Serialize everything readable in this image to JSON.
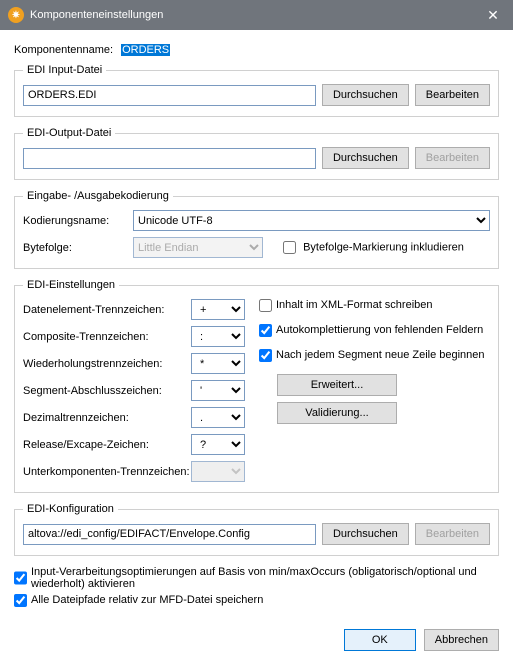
{
  "titlebar": {
    "title": "Komponenteneinstellungen"
  },
  "componentName": {
    "label": "Komponentenname:",
    "value": "ORDERS"
  },
  "ediInput": {
    "legend": "EDI Input-Datei",
    "value": "ORDERS.EDI",
    "browse": "Durchsuchen",
    "edit": "Bearbeiten"
  },
  "ediOutput": {
    "legend": "EDI-Output-Datei",
    "value": "",
    "browse": "Durchsuchen",
    "edit": "Bearbeiten"
  },
  "encoding": {
    "legend": "Eingabe- /Ausgabekodierung",
    "nameLabel": "Kodierungsname:",
    "nameValue": "Unicode UTF-8",
    "byteOrderLabel": "Bytefolge:",
    "byteOrderValue": "Little Endian",
    "bomLabel": "Bytefolge-Markierung inkludieren"
  },
  "ediSettings": {
    "legend": "EDI-Einstellungen",
    "separators": {
      "dataElement": {
        "label": "Datenelement-Trennzeichen:",
        "value": "+"
      },
      "composite": {
        "label": "Composite-Trennzeichen:",
        "value": ":"
      },
      "repetition": {
        "label": "Wiederholungstrennzeichen:",
        "value": "*"
      },
      "segment": {
        "label": "Segment-Abschlusszeichen:",
        "value": "'"
      },
      "decimal": {
        "label": "Dezimaltrennzeichen:",
        "value": "."
      },
      "release": {
        "label": "Release/Excape-Zeichen:",
        "value": "?"
      },
      "subcomp": {
        "label": "Unterkomponenten-Trennzeichen:",
        "value": ""
      }
    },
    "rightOptions": {
      "writeXml": "Inhalt im XML-Format schreiben",
      "autoComplete": "Autokomplettierung von fehlenden Feldern",
      "newLine": "Nach jedem Segment neue Zeile beginnen"
    },
    "extendedBtn": "Erweitert...",
    "validateBtn": "Validierung..."
  },
  "ediConfig": {
    "legend": "EDI-Konfiguration",
    "value": "altova://edi_config/EDIFACT/Envelope.Config",
    "browse": "Durchsuchen",
    "edit": "Bearbeiten"
  },
  "bottom": {
    "optimize": "Input-Verarbeitungsoptimierungen auf Basis von min/maxOccurs (obligatorisch/optional und wiederholt) aktivieren",
    "relative": "Alle Dateipfade relativ zur MFD-Datei speichern"
  },
  "footer": {
    "ok": "OK",
    "cancel": "Abbrechen"
  }
}
